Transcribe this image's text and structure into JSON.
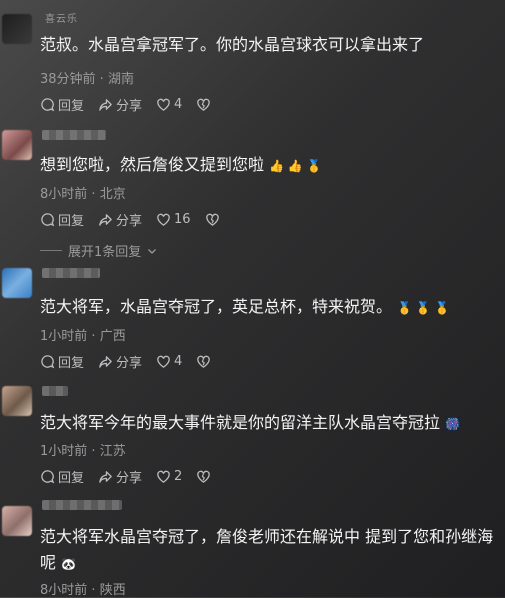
{
  "comments": [
    {
      "username": "喜云乐",
      "text": "范叔。水晶宫拿冠军了。你的水晶宫球衣可以拿出来了",
      "time": "38分钟前",
      "location": "湖南",
      "reply_label": "回复",
      "share_label": "分享",
      "likes": "4"
    },
    {
      "username": "",
      "text": "想到您啦，然后詹俊又提到您啦",
      "emojis": "👍 👍 🥇",
      "time": "8小时前",
      "location": "北京",
      "reply_label": "回复",
      "share_label": "分享",
      "likes": "16",
      "expand_label": "展开1条回复"
    },
    {
      "username": "",
      "text": "范大将军，水晶宫夺冠了，英足总杯，特来祝贺。",
      "emojis": "🥇 🥇 🥇",
      "time": "1小时前",
      "location": "广西",
      "reply_label": "回复",
      "share_label": "分享",
      "likes": "4"
    },
    {
      "username": "",
      "text": "范大将军今年的最大事件就是你的留洋主队水晶宫夺冠拉",
      "emojis": "🎆",
      "time": "1小时前",
      "location": "江苏",
      "reply_label": "回复",
      "share_label": "分享",
      "likes": "2"
    },
    {
      "username": "",
      "text": "范大将军水晶宫夺冠了，詹俊老师还在解说中 提到了您和孙继海呢",
      "emojis": "🐼",
      "time": "8小时前",
      "location": "陕西"
    }
  ],
  "colors": {
    "avatar1": "#2a2a2a",
    "avatar2": "#c98a8a",
    "avatar3": "#3b7fc4",
    "avatar4": "#b79a86",
    "avatar5": "#c9a7a0"
  }
}
